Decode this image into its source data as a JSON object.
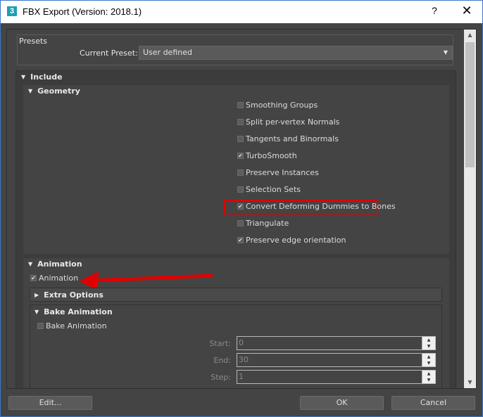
{
  "window": {
    "title": "FBX Export (Version: 2018.1)",
    "app_icon_label": "3",
    "help_glyph": "?",
    "close_glyph": "✕",
    "border_color": "#3c78c8"
  },
  "presets": {
    "title": "Presets",
    "current_preset_label": "Current Preset:",
    "current_preset_value": "User defined"
  },
  "include": {
    "title": "Include",
    "geometry": {
      "title": "Geometry",
      "options": [
        {
          "label": "Smoothing Groups",
          "checked": false
        },
        {
          "label": "Split per-vertex Normals",
          "checked": false
        },
        {
          "label": "Tangents and Binormals",
          "checked": false
        },
        {
          "label": "TurboSmooth",
          "checked": true
        },
        {
          "label": "Preserve Instances",
          "checked": false
        },
        {
          "label": "Selection Sets",
          "checked": false
        },
        {
          "label": "Convert Deforming Dummies to Bones",
          "checked": true,
          "highlighted": true
        },
        {
          "label": "Triangulate",
          "checked": false
        },
        {
          "label": "Preserve edge orientation",
          "checked": true
        }
      ]
    },
    "animation": {
      "title": "Animation",
      "animation_checkbox": {
        "label": "Animation",
        "checked": true
      },
      "extra_options_title": "Extra Options",
      "bake_animation": {
        "title": "Bake Animation",
        "checkbox": {
          "label": "Bake Animation",
          "checked": false
        },
        "start_label": "Start:",
        "start_value": "0",
        "end_label": "End:",
        "end_value": "30",
        "step_label": "Step:",
        "step_value": "1"
      }
    }
  },
  "buttons": {
    "edit": "Edit...",
    "ok": "OK",
    "cancel": "Cancel"
  },
  "annotations": {
    "highlight_color": "#e00000",
    "arrow_color": "#e00000"
  }
}
